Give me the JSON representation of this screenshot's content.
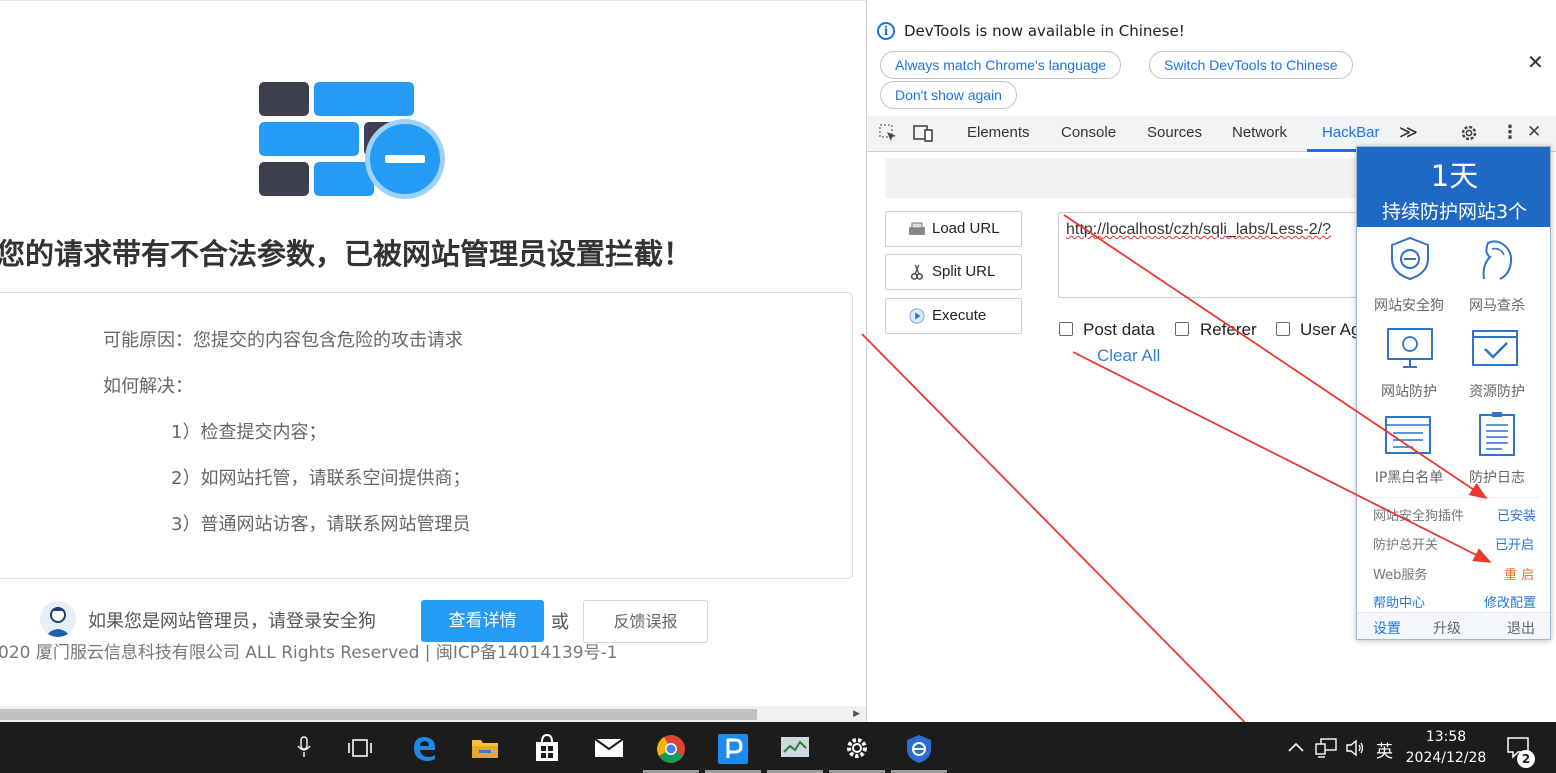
{
  "blocked_page": {
    "headline": "您的请求带有不合法参数，已被网站管理员设置拦截！",
    "reason": "可能原因：您提交的内容包含危险的攻击请求",
    "how_to": "如何解决：",
    "step1": "1）检查提交内容；",
    "step2": "2）如网站托管，请联系空间提供商；",
    "step3": "3）普通网站访客，请联系网站管理员",
    "admin_prompt": "如果您是网站管理员，请登录安全狗",
    "detail_button": "查看详情",
    "or": "或",
    "report_button": "反馈误报",
    "footer": "020 厦门服云信息科技有限公司 ALL Rights Reserved | 闽ICP备14014139号-1"
  },
  "devtools": {
    "infobar": {
      "message": "DevTools is now available in Chinese!",
      "btn_match": "Always match Chrome's language",
      "btn_switch": "Switch DevTools to Chinese",
      "btn_dismiss": "Don't show again",
      "close": "✕"
    },
    "tabs": {
      "elements": "Elements",
      "console": "Console",
      "sources": "Sources",
      "network": "Network",
      "hackbar": "HackBar",
      "more": "≫"
    },
    "hackbar": {
      "load_url": "Load URL",
      "split_url": "Split URL",
      "execute": "Execute",
      "url_value": "http://localhost/czh/sqli_labs/Less-2/?",
      "post_data": "Post data",
      "referer": "Referer",
      "user_agent": "User Ag",
      "clear_all": "Clear All"
    }
  },
  "safedog_popup": {
    "days": "1天",
    "subtitle": "持续防护网站3个",
    "grid": {
      "site_dog": "网站安全狗",
      "trojan_scan": "网马查杀",
      "site_protect": "网站防护",
      "resource_protect": "资源防护",
      "ip_list": "IP黑白名单",
      "protect_log": "防护日志"
    },
    "status": {
      "plugin_label": "网站安全狗插件",
      "plugin_value": "已安装",
      "switch_label": "防护总开关",
      "switch_value": "已开启",
      "web_label": "Web服务",
      "web_value": "重 启",
      "help": "帮助中心",
      "config": "修改配置"
    },
    "footer": {
      "settings": "设置",
      "upgrade": "升级",
      "exit": "退出"
    }
  },
  "taskbar": {
    "ime": "英",
    "time": "13:58",
    "date": "2024/12/28",
    "notification_count": "2"
  }
}
